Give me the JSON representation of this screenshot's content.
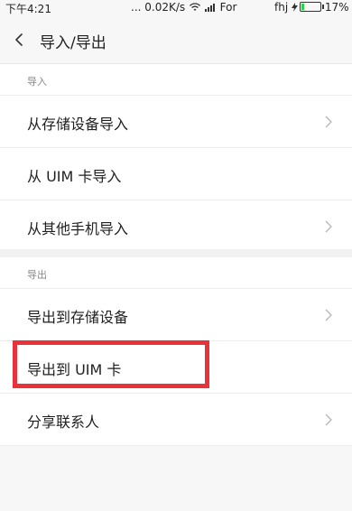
{
  "status_bar": {
    "time": "下午4:21",
    "network": "... 0.02K/s",
    "carrier": "For",
    "user": "fhj",
    "battery_percent": "17%",
    "battery_level": 0.17
  },
  "header": {
    "title": "导入/导出"
  },
  "sections": {
    "import": {
      "header": "导入",
      "items": [
        {
          "label": "从存储设备导入"
        },
        {
          "label": "从 UIM 卡导入"
        },
        {
          "label": "从其他手机导入"
        }
      ]
    },
    "export": {
      "header": "导出",
      "items": [
        {
          "label": "导出到存储设备"
        },
        {
          "label": "导出到 UIM 卡"
        },
        {
          "label": "分享联系人"
        }
      ]
    }
  },
  "colors": {
    "highlight": "#e8333b",
    "battery": "#2bd14b"
  }
}
